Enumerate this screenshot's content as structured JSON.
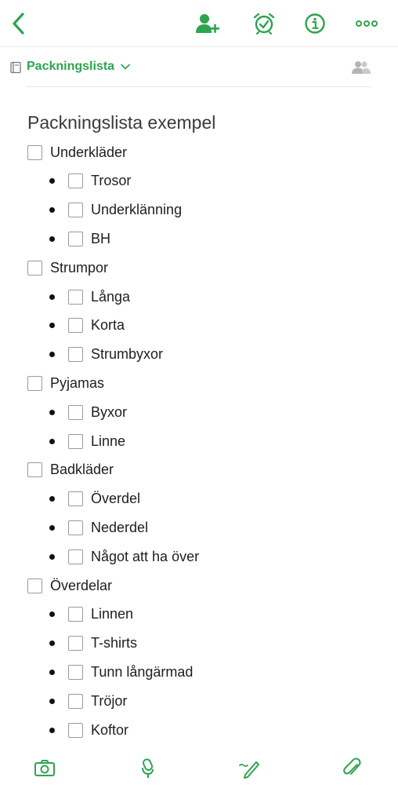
{
  "toolbar": {
    "back_icon": "chevron-left-icon",
    "icons": [
      "add-person-icon",
      "alarm-clock-icon",
      "info-icon",
      "more-icon"
    ]
  },
  "notebook": {
    "name": "Packningslista"
  },
  "note": {
    "title": "Packningslista exempel"
  },
  "checklist": [
    {
      "label": "Underkläder",
      "children": [
        "Trosor",
        "Underklänning",
        "BH"
      ]
    },
    {
      "label": "Strumpor",
      "children": [
        "Långa",
        "Korta",
        "Strumbyxor"
      ]
    },
    {
      "label": "Pyjamas",
      "children": [
        "Byxor",
        "Linne"
      ]
    },
    {
      "label": "Badkläder",
      "children": [
        "Överdel",
        "Nederdel",
        "Något att ha över"
      ]
    },
    {
      "label": "Överdelar",
      "children": [
        "Linnen",
        "T-shirts",
        "Tunn långärmad",
        "Tröjor",
        "Koftor"
      ]
    }
  ],
  "bottom_toolbar": {
    "icons": [
      "camera-icon",
      "microphone-icon",
      "pen-icon",
      "paperclip-icon"
    ]
  },
  "colors": {
    "accent": "#2da44e",
    "text": "#1e1e1e",
    "checkbox_border": "#9a9a9a"
  }
}
